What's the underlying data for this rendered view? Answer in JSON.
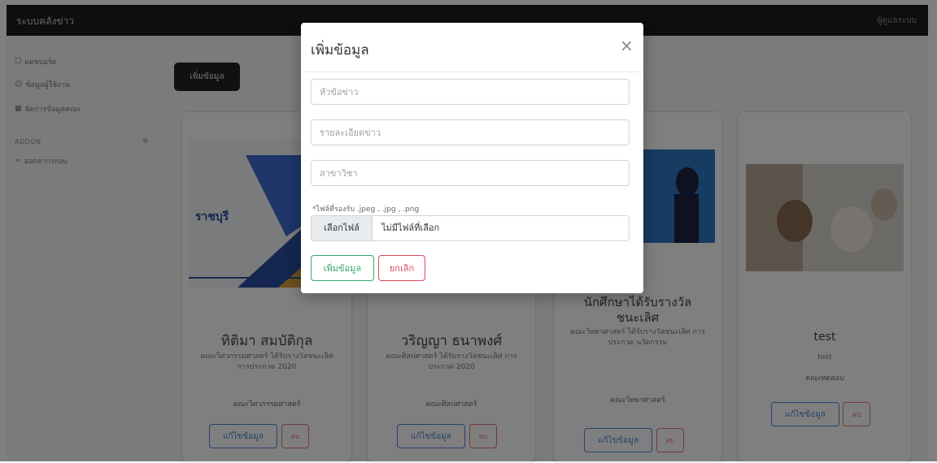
{
  "topbar": {
    "brand": "ระบบคลังข่าว",
    "user": "ผู้ดูแลระบบ"
  },
  "sidebar": {
    "items": [
      {
        "label": "แดชบอร์ด"
      },
      {
        "label": "ข้อมูลผู้ใช้งาน"
      },
      {
        "label": "จัดการข้อมูลคณะ"
      }
    ],
    "section": "ADDON",
    "sub_items": [
      {
        "label": "ออกจากระบบ"
      }
    ]
  },
  "main": {
    "add_button": "เพิ่มข้อมูล"
  },
  "cards": [
    {
      "title": "ทิติมา สมบัติกุล",
      "desc": "คณะวิศวกรรมศาสตร์ ได้รับรางวัลชนะเลิศ การประกวด 2020",
      "dept": "คณะวิศวกรรมศาสตร์",
      "edit": "แก้ไขข้อมูล",
      "delete": "ลบ"
    },
    {
      "title": "วริญญา ธนาพงศ์",
      "desc": "คณะศิลปศาสตร์ ได้รับรางวัลชนะเลิศ การประกวด 2020",
      "dept": "คณะศิลปศาสตร์",
      "edit": "แก้ไขข้อมูล",
      "delete": "ลบ"
    },
    {
      "title_line1": "นักศึกษาได้รับรางวัล",
      "title_line2": "ชนะเลิศ",
      "desc": "คณะวิทยาศาสตร์ ได้รับรางวัลชนะเลิศ การประกวด นวัตกรรม",
      "dept": "คณะวิทยาศาสตร์",
      "edit": "แก้ไขข้อมูล",
      "delete": "ลบ"
    },
    {
      "title": "test",
      "desc": "test",
      "dept": "คณะทดสอบ",
      "edit": "แก้ไขข้อมูล",
      "delete": "ลบ"
    }
  ],
  "modal": {
    "title": "เพิ่มข้อมูล",
    "close": "×",
    "fields": {
      "title_placeholder": "หัวข้อข่าว",
      "detail_placeholder": "รายละเอียดข่าว",
      "dept_placeholder": "สาขาวิชา"
    },
    "file_hint": "*ไฟล์ที่รองรับ .jpeg , .jpg , .png",
    "file_button": "เลือกไฟล์",
    "file_status": "ไม่มีไฟล์ที่เลือก",
    "submit": "เพิ่มข้อมูล",
    "cancel": "ยกเลิก"
  },
  "colors": {
    "topbar_bg": "#1a1d20",
    "overlay": "rgba(0,0,0,0.5)",
    "submit_accent": "#3aa76d",
    "cancel_accent": "#dc4a5a",
    "edit_accent": "#4a84d8"
  }
}
